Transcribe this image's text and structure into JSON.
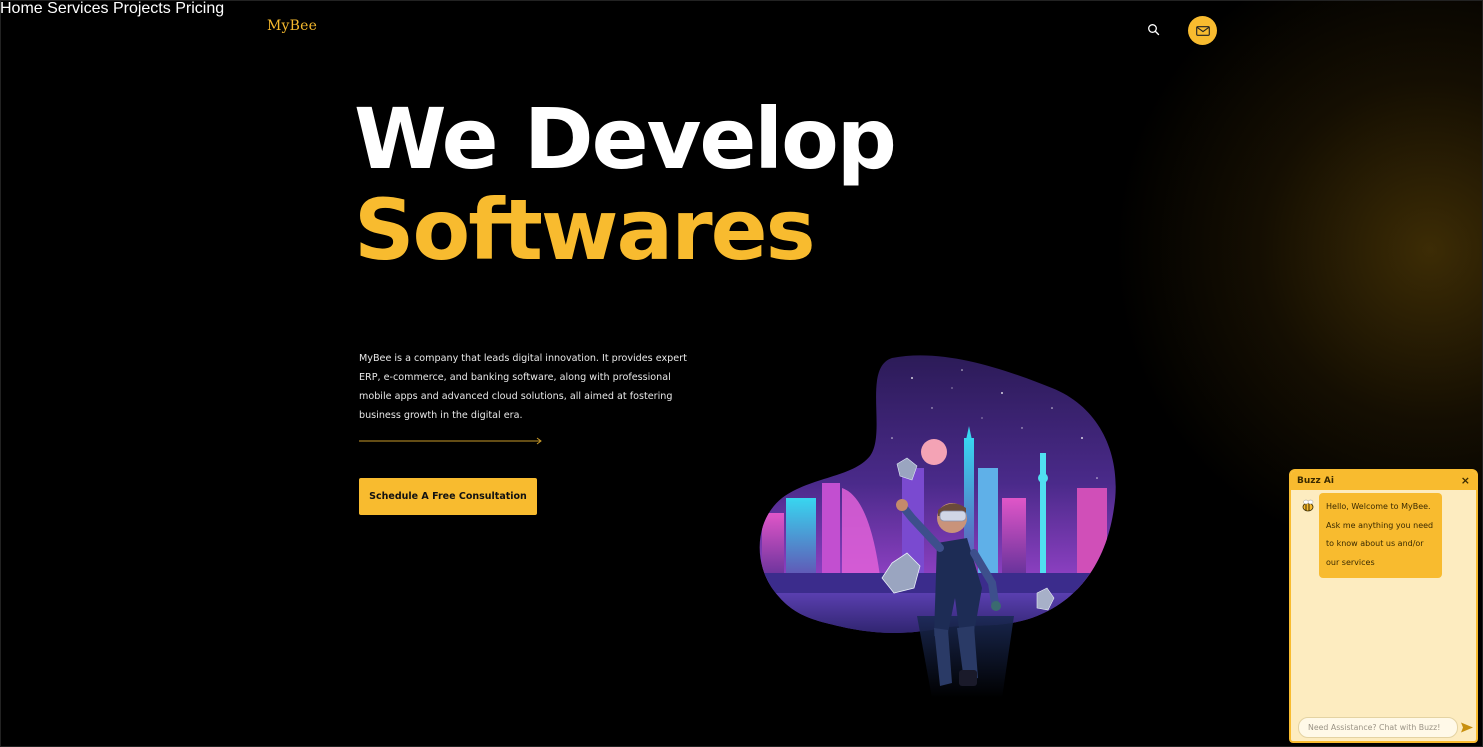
{
  "brand": {
    "logo_text": "MyBee",
    "accent_color": "#f8bb2f"
  },
  "nav": {
    "items": [
      {
        "label": "Home"
      },
      {
        "label": "Services"
      },
      {
        "label": "Projects"
      },
      {
        "label": "Pricing"
      }
    ],
    "search_icon": "search-icon",
    "mail_icon": "mail-icon"
  },
  "hero": {
    "title_line1": "We Develop",
    "title_line2": "Softwares",
    "description": "MyBee is a company that leads digital innovation. It provides expert ERP, e-commerce, and banking software, along with professional mobile apps and advanced cloud solutions, all aimed at fostering business growth in the digital era.",
    "cta_label": "Schedule A Free Consultation"
  },
  "chat": {
    "title": "Buzz Ai",
    "close_label": "×",
    "bot_icon": "bee-icon",
    "welcome_message": "Hello, Welcome to MyBee. Ask me anything you need to know about us and/or our services",
    "input_placeholder": "Need Assistance? Chat with Buzz!",
    "send_icon": "send-icon"
  }
}
